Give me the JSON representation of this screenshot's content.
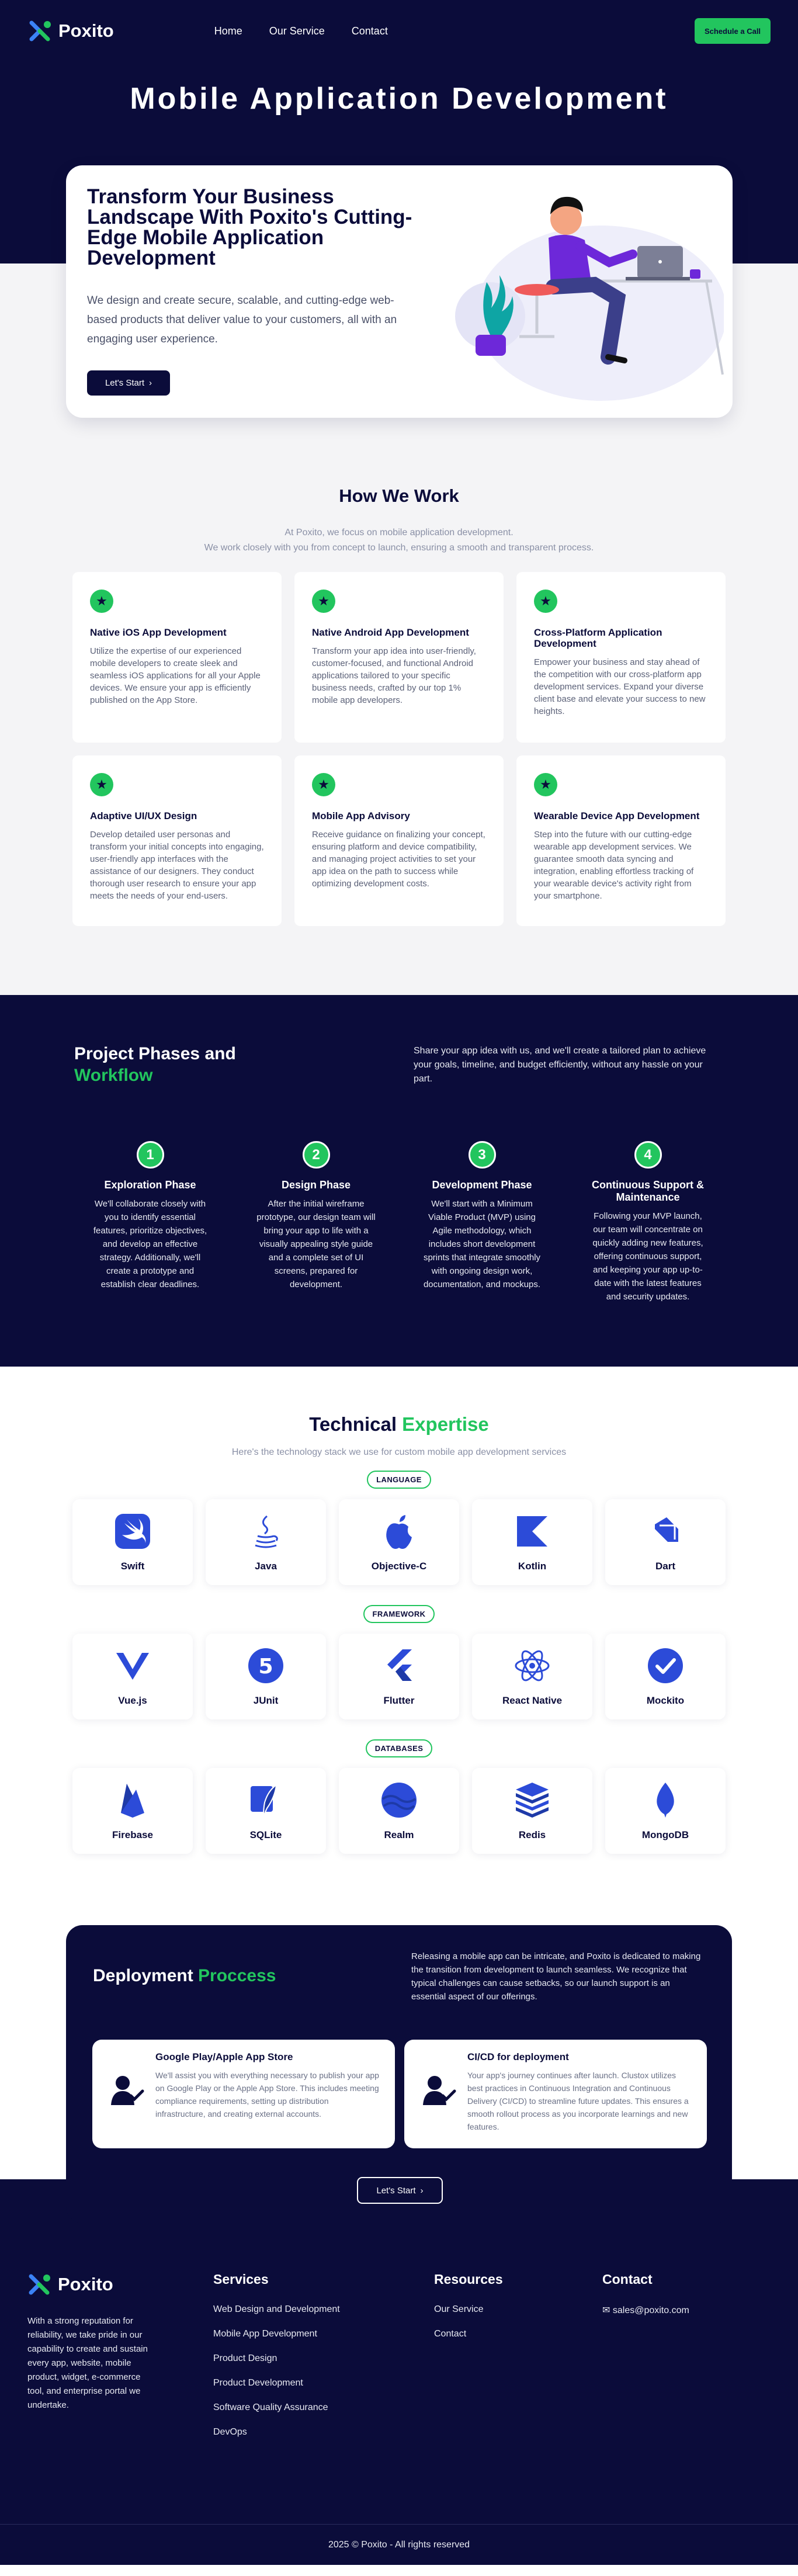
{
  "brand": {
    "name": "Poxito",
    "accent": "#22c55e",
    "navy": "#0b0c3a"
  },
  "nav": {
    "links": [
      "Home",
      "Our Service",
      "Contact"
    ],
    "cta": "Schedule a Call"
  },
  "hero": {
    "title": "Mobile Application Development",
    "heading": "Transform Your Business Landscape With Poxito's Cutting-Edge Mobile Application Development",
    "text": "We design and create secure, scalable, and cutting-edge web-based products that deliver value to your customers, all with an engaging user experience.",
    "button": "Let's Start"
  },
  "how": {
    "title": "How We Work",
    "sub1": "At Poxito, we focus on mobile application development.",
    "sub2": "We work closely with you from concept to launch, ensuring a smooth and transparent process.",
    "cards": [
      {
        "title": "Native iOS App Development",
        "text": "Utilize the expertise of our experienced mobile developers to create sleek and seamless iOS applications for all your Apple devices. We ensure your app is efficiently published on the App Store."
      },
      {
        "title": "Native Android App Development",
        "text": "Transform your app idea into user-friendly, customer-focused, and functional Android applications tailored to your specific business needs, crafted by our top 1% mobile app developers."
      },
      {
        "title": "Cross-Platform Application Development",
        "text": "Empower your business and stay ahead of the competition with our cross-platform app development services. Expand your diverse client base and elevate your success to new heights."
      },
      {
        "title": "Adaptive UI/UX Design",
        "text": "Develop detailed user personas and transform your initial concepts into engaging, user-friendly app interfaces with the assistance of our designers. They conduct thorough user research to ensure your app meets the needs of your end-users."
      },
      {
        "title": "Mobile App Advisory",
        "text": "Receive guidance on finalizing your concept, ensuring platform and device compatibility, and managing project activities to set your app idea on the path to success while optimizing development costs."
      },
      {
        "title": "Wearable Device App Development",
        "text": "Step into the future with our cutting-edge wearable app development services. We guarantee smooth data syncing and integration, enabling effortless tracking of your wearable device's activity right from your smartphone."
      }
    ]
  },
  "phases": {
    "title1": "Project Phases and",
    "title2": "Workflow",
    "intro": "Share your app idea with us, and we'll create a tailored plan to achieve your goals, timeline, and budget efficiently, without any hassle on your part.",
    "steps": [
      {
        "num": "1",
        "title": "Exploration Phase",
        "text": "We'll collaborate closely with you to identify essential features, prioritize objectives, and develop an effective strategy. Additionally, we'll create a prototype and establish clear deadlines."
      },
      {
        "num": "2",
        "title": "Design Phase",
        "text": "After the initial wireframe prototype, our design team will bring your app to life with a visually appealing style guide and a complete set of UI screens, prepared for development."
      },
      {
        "num": "3",
        "title": "Development Phase",
        "text": "We'll start with a Minimum Viable Product (MVP) using Agile methodology, which includes short development sprints that integrate smoothly with ongoing design work, documentation, and mockups."
      },
      {
        "num": "4",
        "title": "Continuous Support & Maintenance",
        "text": "Following your MVP launch, our team will concentrate on quickly adding new features, offering continuous support, and keeping your app up-to-date with the latest features and security updates."
      }
    ]
  },
  "expertise": {
    "title1": "Technical",
    "title2": "Expertise",
    "sub": "Here's the technology stack we use for custom mobile app development services",
    "groups": [
      {
        "label": "LANGUAGE",
        "items": [
          {
            "name": "Swift",
            "icon": "swift-icon"
          },
          {
            "name": "Java",
            "icon": "java-icon"
          },
          {
            "name": "Objective-C",
            "icon": "apple-icon"
          },
          {
            "name": "Kotlin",
            "icon": "kotlin-icon"
          },
          {
            "name": "Dart",
            "icon": "dart-icon"
          }
        ]
      },
      {
        "label": "FRAMEWORK",
        "items": [
          {
            "name": "Vue.js",
            "icon": "vue-icon"
          },
          {
            "name": "JUnit",
            "icon": "junit-icon"
          },
          {
            "name": "Flutter",
            "icon": "flutter-icon"
          },
          {
            "name": "React Native",
            "icon": "react-icon"
          },
          {
            "name": "Mockito",
            "icon": "mockito-icon"
          }
        ]
      },
      {
        "label": "DATABASES",
        "items": [
          {
            "name": "Firebase",
            "icon": "firebase-icon"
          },
          {
            "name": "SQLite",
            "icon": "sqlite-icon"
          },
          {
            "name": "Realm",
            "icon": "realm-icon"
          },
          {
            "name": "Redis",
            "icon": "redis-icon"
          },
          {
            "name": "MongoDB",
            "icon": "mongodb-icon"
          }
        ]
      }
    ]
  },
  "deploy": {
    "title1": "Deployment",
    "title2": "Proccess",
    "intro": "Releasing a mobile app can be intricate, and Poxito is dedicated to making the transition from development to launch seamless. We recognize that typical challenges can cause setbacks, so our launch support is an essential aspect of our offerings.",
    "cards": [
      {
        "title": "Google Play/Apple App Store",
        "text": "We'll assist you with everything necessary to publish your app on Google Play or the Apple App Store. This includes meeting compliance requirements, setting up distribution infrastructure, and creating external accounts."
      },
      {
        "title": "CI/CD for deployment",
        "text": "Your app's journey continues after launch. Clustox utilizes best practices in Continuous Integration and Continuous Delivery (CI/CD) to streamline future updates. This ensures a smooth rollout process as you incorporate learnings and new features."
      }
    ],
    "button": "Let's Start"
  },
  "footer": {
    "about": "With a strong reputation for reliability, we take pride in our capability to create and sustain every app, website, mobile product, widget, e-commerce tool, and enterprise portal we undertake.",
    "services_title": "Services",
    "services": [
      "Web Design and Development",
      "Mobile App Development",
      "Product Design",
      "Product Development",
      "Software Quality Assurance",
      "DevOps"
    ],
    "resources_title": "Resources",
    "resources": [
      "Our Service",
      "Contact"
    ],
    "contact_title": "Contact",
    "email": "sales@poxito.com",
    "copyright": "2025 © Poxito - All rights reserved"
  }
}
